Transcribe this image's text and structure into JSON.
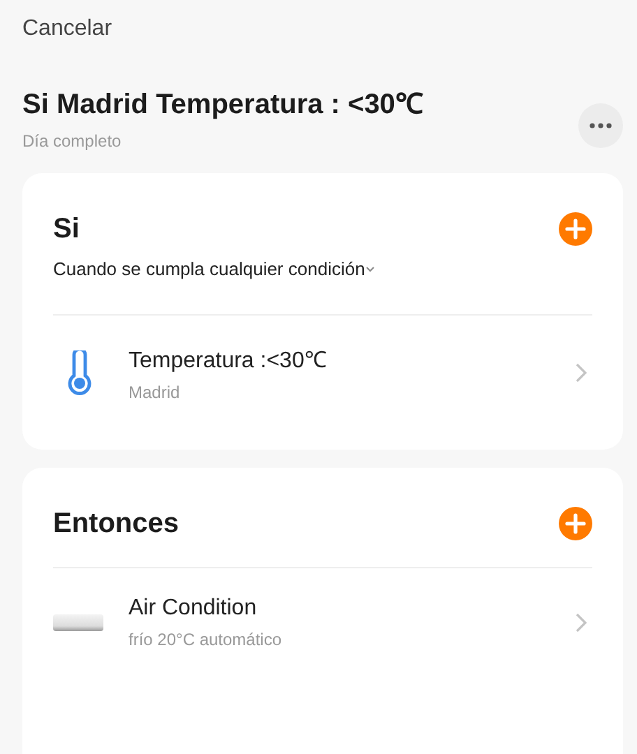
{
  "header": {
    "cancel": "Cancelar",
    "title": "Si Madrid Temperatura : <30℃",
    "subtitle": "Día completo"
  },
  "sections": [
    {
      "title": "Si",
      "condition": "Cuando se cumpla cualquier condición",
      "items": [
        {
          "kind": "thermometer",
          "title": "Temperatura :<30℃",
          "subtitle": "Madrid"
        }
      ]
    },
    {
      "title": "Entonces",
      "items": [
        {
          "kind": "aircon",
          "title": "Air Condition",
          "subtitle": "frío 20°C automático"
        }
      ]
    }
  ]
}
